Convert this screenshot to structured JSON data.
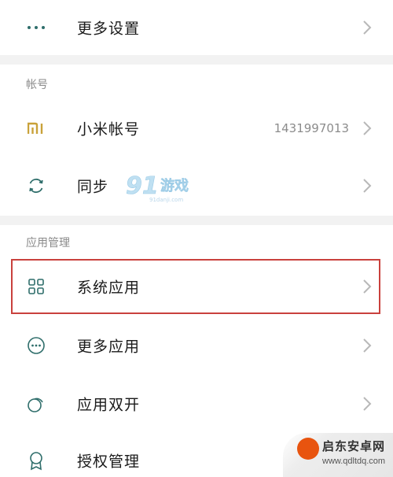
{
  "colors": {
    "icon": "#2f6e6b",
    "mi_icon": "#c9a23a",
    "highlight": "#c9413d",
    "divider": "#f2f2f2",
    "chevron": "#b8b8b8"
  },
  "top": {
    "more_settings": {
      "label": "更多设置",
      "icon": "dots-icon"
    }
  },
  "account": {
    "section_title": "帐号",
    "items": [
      {
        "label": "小米帐号",
        "value": "1431997013",
        "icon": "mi-logo-icon"
      },
      {
        "label": "同步",
        "value": "",
        "icon": "sync-icon"
      }
    ]
  },
  "apps": {
    "section_title": "应用管理",
    "items": [
      {
        "label": "系统应用",
        "icon": "grid-icon",
        "highlighted": true
      },
      {
        "label": "更多应用",
        "icon": "more-circle-icon"
      },
      {
        "label": "应用双开",
        "icon": "dual-circle-icon"
      },
      {
        "label": "授权管理",
        "icon": "badge-icon"
      }
    ]
  },
  "watermarks": {
    "center": "91游戏",
    "center_sub": "91danji.com",
    "corner_brand": "启东安卓网",
    "corner_site": "www.qdltdq.com"
  }
}
